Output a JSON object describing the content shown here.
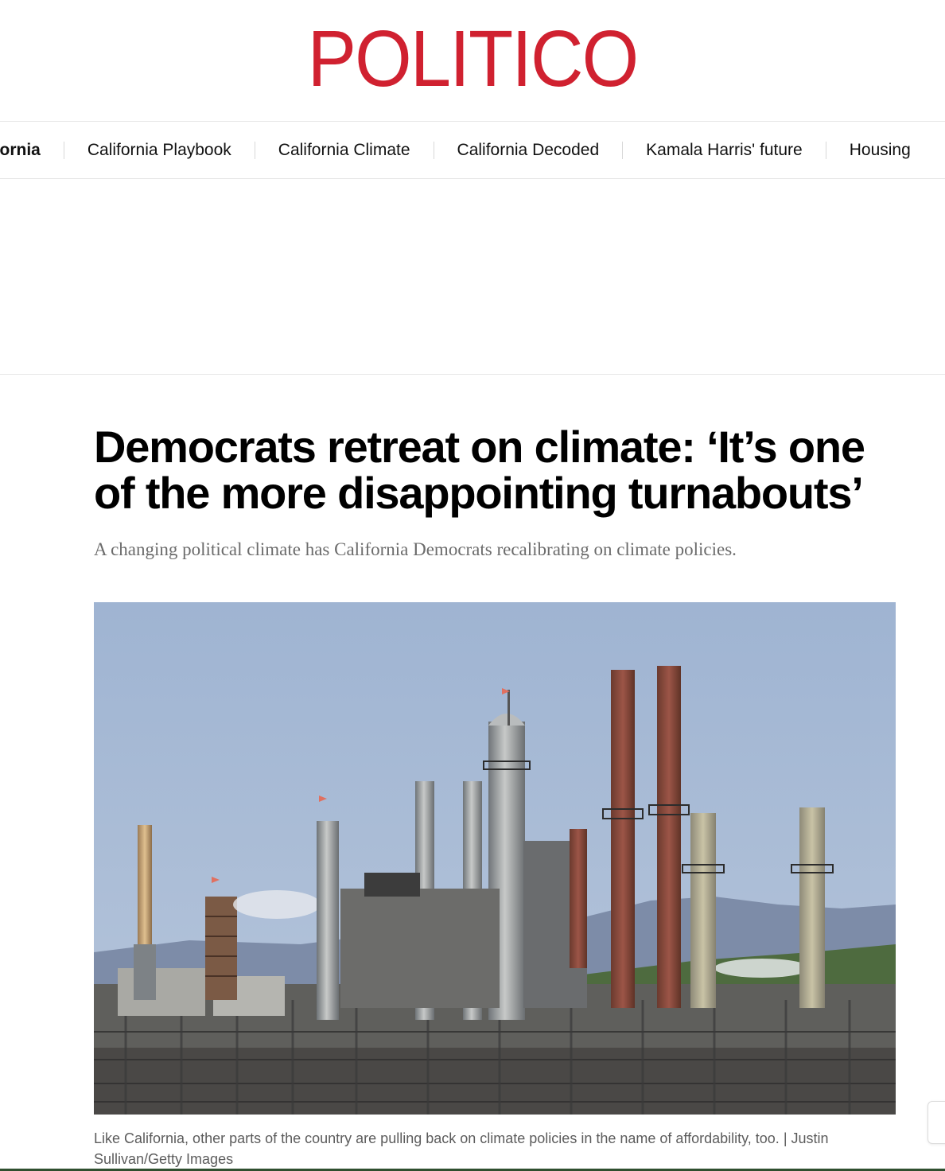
{
  "brand": {
    "logo_text": "POLITICO",
    "logo_color": "#d02130"
  },
  "nav": {
    "items": [
      {
        "label": "California"
      },
      {
        "label": "California Playbook"
      },
      {
        "label": "California Climate"
      },
      {
        "label": "California Decoded"
      },
      {
        "label": "Kamala Harris' future"
      },
      {
        "label": "Housing"
      }
    ]
  },
  "article": {
    "headline": "Democrats retreat on climate: ‘It’s one of the more disappointing turnabouts’",
    "dek": "A changing political climate has California Democrats recalibrating on climate policies.",
    "image": {
      "icon": "refinery-photo"
    },
    "caption": "Like California, other parts of the country are pulling back on climate policies in the name of affordability, too.",
    "credit": "Justin Sullivan/Getty Images"
  }
}
